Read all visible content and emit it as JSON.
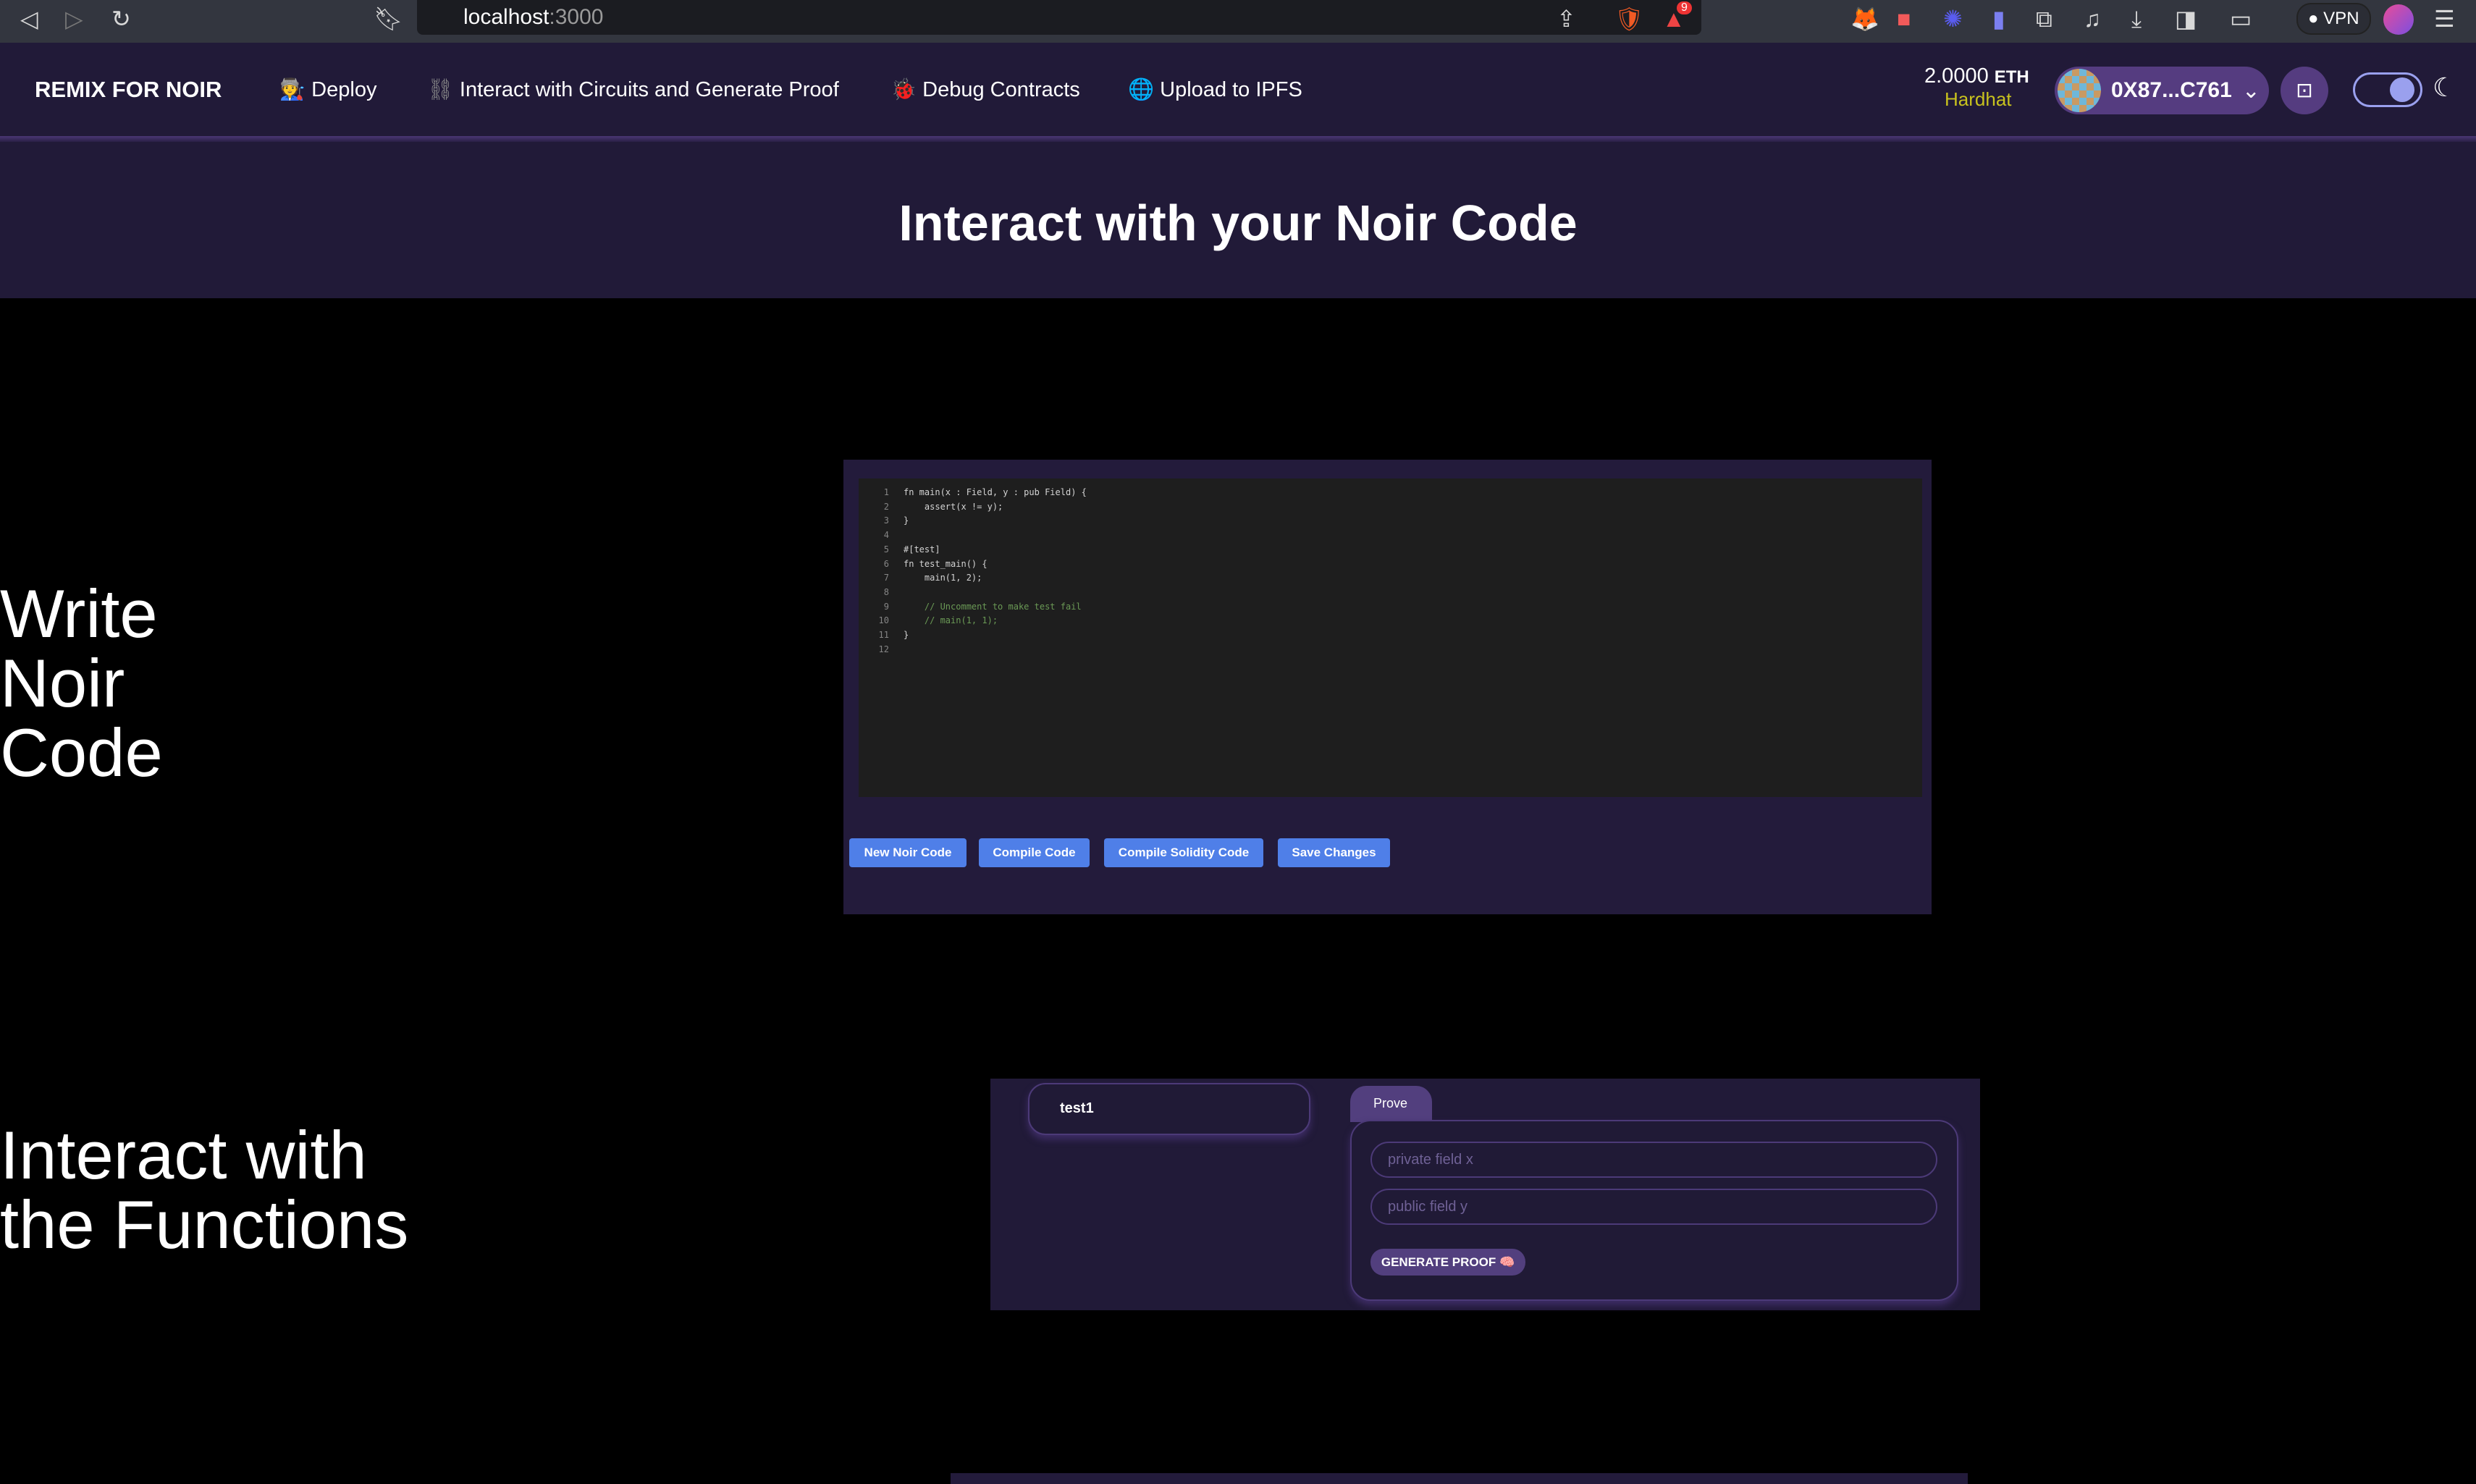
{
  "browser": {
    "url_host": "localhost",
    "url_port": ":3000",
    "vpn_label": "VPN",
    "extension_badge": "9"
  },
  "nav": {
    "brand": "REMIX FOR NOIR",
    "items": [
      {
        "label": "Deploy",
        "icon": "🧑‍🏭"
      },
      {
        "label": "Interact with Circuits and Generate Proof",
        "icon": "⛓"
      },
      {
        "label": "Debug Contracts",
        "icon": "🐞"
      },
      {
        "label": "Upload to IPFS",
        "icon": "🌐"
      }
    ],
    "balance": "2.0000",
    "currency": "ETH",
    "network": "Hardhat",
    "account": "0X87...C761"
  },
  "hero": {
    "title": "Interact with your Noir Code"
  },
  "section1": {
    "heading_lines": [
      "Write",
      "Noir",
      "Code"
    ],
    "code_lines": [
      "fn main(x : Field, y : pub Field) {",
      "    assert(x != y);",
      "}",
      "",
      "#[test]",
      "fn test_main() {",
      "    main(1, 2);",
      "",
      "    // Uncomment to make test fail",
      "    // main(1, 1);",
      "}",
      ""
    ],
    "buttons": [
      "New Noir Code",
      "Compile Code",
      "Compile Solidity Code",
      "Save Changes"
    ]
  },
  "section2": {
    "heading_lines": [
      "Interact with",
      "the Functions"
    ],
    "function_name": "test1",
    "tab": "Prove",
    "inputs": [
      {
        "placeholder": "private field x",
        "value": ""
      },
      {
        "placeholder": "public field y",
        "value": ""
      }
    ],
    "generate_label": "GENERATE PROOF 🧠"
  },
  "colors": {
    "nav_bg": "#211a38",
    "button_blue": "#4f7fe8",
    "accent_purple": "#553c80",
    "network": "#c8c21e"
  }
}
